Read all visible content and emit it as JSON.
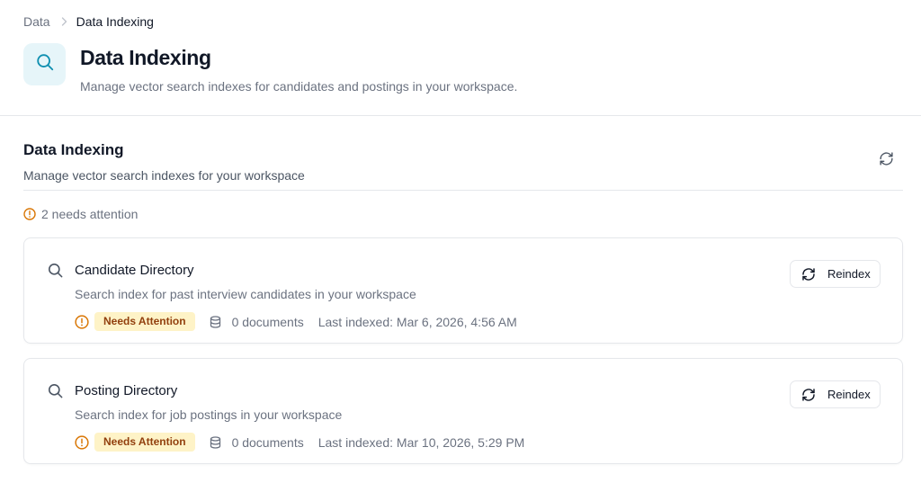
{
  "breadcrumb": {
    "parent": "Data",
    "current": "Data Indexing"
  },
  "header": {
    "title": "Data Indexing",
    "subtitle": "Manage vector search indexes for candidates and postings in your workspace.",
    "icon": "search-icon",
    "icon_color": "#0e8fb0",
    "icon_bg": "#e6f5f9"
  },
  "section": {
    "title": "Data Indexing",
    "subtitle": "Manage vector search indexes for your workspace",
    "refresh_icon": "refresh-icon"
  },
  "attention": {
    "text": "2 needs attention",
    "color": "#d97706"
  },
  "indexes": [
    {
      "name": "Candidate Directory",
      "description": "Search index for past interview candidates in your workspace",
      "status": "Needs Attention",
      "documents": "0 documents",
      "last_indexed": "Last indexed: Mar 6, 2026, 4:56 AM",
      "action": "Reindex"
    },
    {
      "name": "Posting Directory",
      "description": "Search index for job postings in your workspace",
      "status": "Needs Attention",
      "documents": "0 documents",
      "last_indexed": "Last indexed: Mar 10, 2026, 5:29 PM",
      "action": "Reindex"
    }
  ],
  "colors": {
    "warning": "#d97706",
    "badge_bg": "#fef3c7",
    "badge_text": "#92400e",
    "border": "#e5e7eb"
  }
}
